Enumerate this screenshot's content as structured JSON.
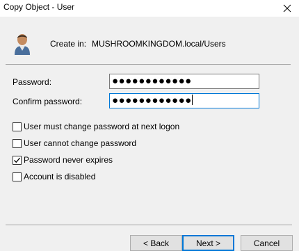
{
  "window": {
    "title": "Copy Object - User"
  },
  "icons": {
    "user": "user-icon",
    "close": "close-icon",
    "check": "check-icon"
  },
  "header": {
    "create_in_label": "Create in:",
    "create_in_value": "MUSHROOMKINGDOM.local/Users"
  },
  "form": {
    "password_label": "Password:",
    "password_value": "●●●●●●●●●●●●",
    "confirm_label": "Confirm password:",
    "confirm_value": "●●●●●●●●●●●●"
  },
  "options": [
    {
      "label": "User must change password at next logon",
      "checked": false
    },
    {
      "label": "User cannot change password",
      "checked": false
    },
    {
      "label": "Password never expires",
      "checked": true
    },
    {
      "label": "Account is disabled",
      "checked": false
    }
  ],
  "buttons": {
    "back": "< Back",
    "next": "Next >",
    "cancel": "Cancel"
  },
  "colors": {
    "accent": "#0078d7",
    "background": "#f0f0f0"
  }
}
